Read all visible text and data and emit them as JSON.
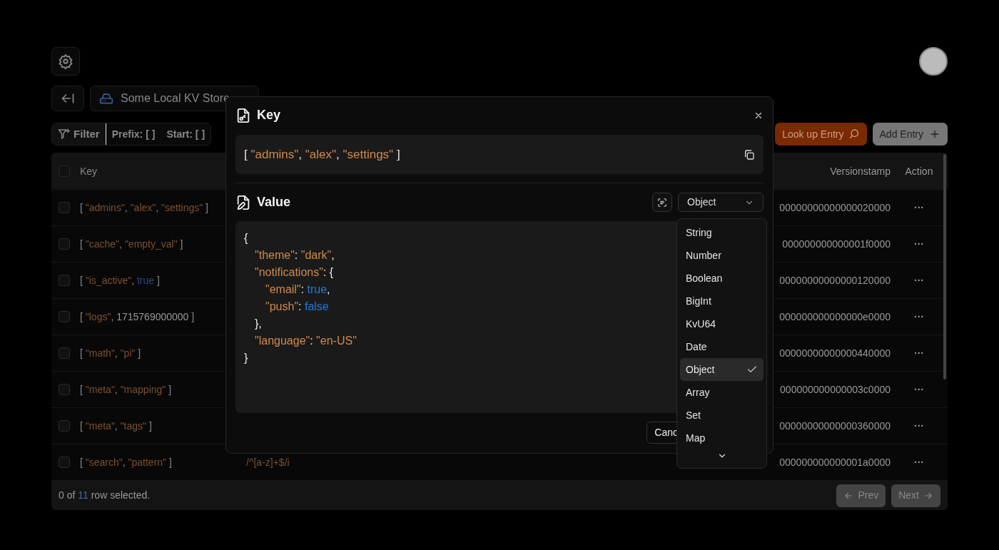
{
  "toolbar": {
    "store_name": "Some Local KV Store",
    "filter": {
      "label": "Filter",
      "segments": [
        "Prefix: [ ]",
        "Start: [ ]"
      ]
    },
    "lookup_button": "Look up Entry",
    "add_button": "Add Entry"
  },
  "table": {
    "all_checked": false,
    "columns": [
      "Key",
      "Versionstamp",
      "Action"
    ],
    "rows": [
      {
        "checked": false,
        "key": [
          {
            "kind": "punct",
            "text": "[ "
          },
          {
            "kind": "string",
            "text": "\"admins\""
          },
          {
            "kind": "punct",
            "text": ", "
          },
          {
            "kind": "string",
            "text": "\"alex\""
          },
          {
            "kind": "punct",
            "text": ", "
          },
          {
            "kind": "string",
            "text": "\"settings\""
          },
          {
            "kind": "punct",
            "text": " ]"
          }
        ],
        "versionstamp": "00000000000000020000",
        "action": "···"
      },
      {
        "checked": false,
        "key": [
          {
            "kind": "punct",
            "text": "[ "
          },
          {
            "kind": "string",
            "text": "\"cache\""
          },
          {
            "kind": "punct",
            "text": ", "
          },
          {
            "kind": "string",
            "text": "\"empty_val\""
          },
          {
            "kind": "punct",
            "text": " ]"
          }
        ],
        "versionstamp": "000000000000001f0000",
        "action": "···"
      },
      {
        "checked": false,
        "key": [
          {
            "kind": "punct",
            "text": "[ "
          },
          {
            "kind": "string",
            "text": "\"is_active\""
          },
          {
            "kind": "punct",
            "text": ", "
          },
          {
            "kind": "boolean",
            "text": "true"
          },
          {
            "kind": "punct",
            "text": " ]"
          }
        ],
        "versionstamp": "00000000000000120000",
        "action": "···"
      },
      {
        "checked": false,
        "key": [
          {
            "kind": "punct",
            "text": "[ "
          },
          {
            "kind": "string",
            "text": "\"logs\""
          },
          {
            "kind": "punct",
            "text": ", "
          },
          {
            "kind": "number",
            "text": "1715769000000"
          },
          {
            "kind": "punct",
            "text": " ]"
          }
        ],
        "versionstamp": "000000000000000e0000",
        "action": "···"
      },
      {
        "checked": false,
        "key": [
          {
            "kind": "punct",
            "text": "[ "
          },
          {
            "kind": "string",
            "text": "\"math\""
          },
          {
            "kind": "punct",
            "text": ", "
          },
          {
            "kind": "string",
            "text": "\"pi\""
          },
          {
            "kind": "punct",
            "text": " ]"
          }
        ],
        "versionstamp": "00000000000000440000",
        "action": "···"
      },
      {
        "checked": false,
        "key": [
          {
            "kind": "punct",
            "text": "[ "
          },
          {
            "kind": "string",
            "text": "\"meta\""
          },
          {
            "kind": "punct",
            "text": ", "
          },
          {
            "kind": "string",
            "text": "\"mapping\""
          },
          {
            "kind": "punct",
            "text": " ]"
          }
        ],
        "versionstamp": "000000000000003c0000",
        "action": "···"
      },
      {
        "checked": false,
        "key": [
          {
            "kind": "punct",
            "text": "[ "
          },
          {
            "kind": "string",
            "text": "\"meta\""
          },
          {
            "kind": "punct",
            "text": ", "
          },
          {
            "kind": "string",
            "text": "\"tags\""
          },
          {
            "kind": "punct",
            "text": " ]"
          }
        ],
        "versionstamp": "00000000000000360000",
        "action": "···"
      },
      {
        "checked": false,
        "key": [
          {
            "kind": "punct",
            "text": "[ "
          },
          {
            "kind": "string",
            "text": "\"search\""
          },
          {
            "kind": "punct",
            "text": ", "
          },
          {
            "kind": "string",
            "text": "\"pattern\""
          },
          {
            "kind": "punct",
            "text": " ]"
          }
        ],
        "value": "/^[a-z]+$/i",
        "versionstamp": "000000000000001a0000",
        "action": "···"
      }
    ]
  },
  "footer": {
    "selection": {
      "prefix": "0 of",
      "count": "11",
      "suffix": "row selected."
    },
    "prev_button": {
      "label": "Prev",
      "disabled": true
    },
    "next_button": {
      "label": "Next",
      "disabled": true
    }
  },
  "dialog": {
    "key_title": "Key",
    "key": [
      {
        "kind": "punct",
        "text": "[ "
      },
      {
        "kind": "string",
        "text": "\"admins\""
      },
      {
        "kind": "punct",
        "text": ", "
      },
      {
        "kind": "string",
        "text": "\"alex\""
      },
      {
        "kind": "punct",
        "text": ", "
      },
      {
        "kind": "string",
        "text": "\"settings\""
      },
      {
        "kind": "punct",
        "text": " ]"
      }
    ],
    "value_title": "Value",
    "type_select": "Object",
    "editor_lines": [
      {
        "tokens": [
          {
            "kind": "punct",
            "text": "{"
          }
        ],
        "children": [
          {
            "tokens": [
              {
                "kind": "string",
                "text": "\"theme\""
              },
              {
                "kind": "punct",
                "text": ": "
              },
              {
                "kind": "string",
                "text": "\"dark\""
              },
              {
                "kind": "punct",
                "text": ","
              }
            ]
          },
          {
            "tokens": [
              {
                "kind": "string",
                "text": "\"notifications\""
              },
              {
                "kind": "punct",
                "text": ": {"
              }
            ],
            "children": [
              {
                "tokens": [
                  {
                    "kind": "string",
                    "text": "\"email\""
                  },
                  {
                    "kind": "punct",
                    "text": ": "
                  },
                  {
                    "kind": "boolean",
                    "text": "true"
                  },
                  {
                    "kind": "punct",
                    "text": ","
                  }
                ]
              },
              {
                "tokens": [
                  {
                    "kind": "string",
                    "text": "\"push\""
                  },
                  {
                    "kind": "punct",
                    "text": ": "
                  },
                  {
                    "kind": "boolean",
                    "text": "false"
                  }
                ]
              }
            ]
          },
          {
            "tokens": [
              {
                "kind": "punct",
                "text": "},"
              }
            ]
          },
          {
            "tokens": [
              {
                "kind": "string",
                "text": "\"language\""
              },
              {
                "kind": "punct",
                "text": ": "
              },
              {
                "kind": "string",
                "text": "\"en-US\""
              }
            ]
          }
        ]
      },
      {
        "tokens": [
          {
            "kind": "punct",
            "text": "}"
          }
        ]
      }
    ],
    "cancel_button": "Canc"
  },
  "type_menu": {
    "options": [
      {
        "label": "String",
        "selected": false
      },
      {
        "label": "Number",
        "selected": false
      },
      {
        "label": "Boolean",
        "selected": false
      },
      {
        "label": "BigInt",
        "selected": false
      },
      {
        "label": "KvU64",
        "selected": false
      },
      {
        "label": "Date",
        "selected": false
      },
      {
        "label": "Object",
        "selected": true
      },
      {
        "label": "Array",
        "selected": false
      },
      {
        "label": "Set",
        "selected": false
      },
      {
        "label": "Map",
        "selected": false
      }
    ]
  }
}
